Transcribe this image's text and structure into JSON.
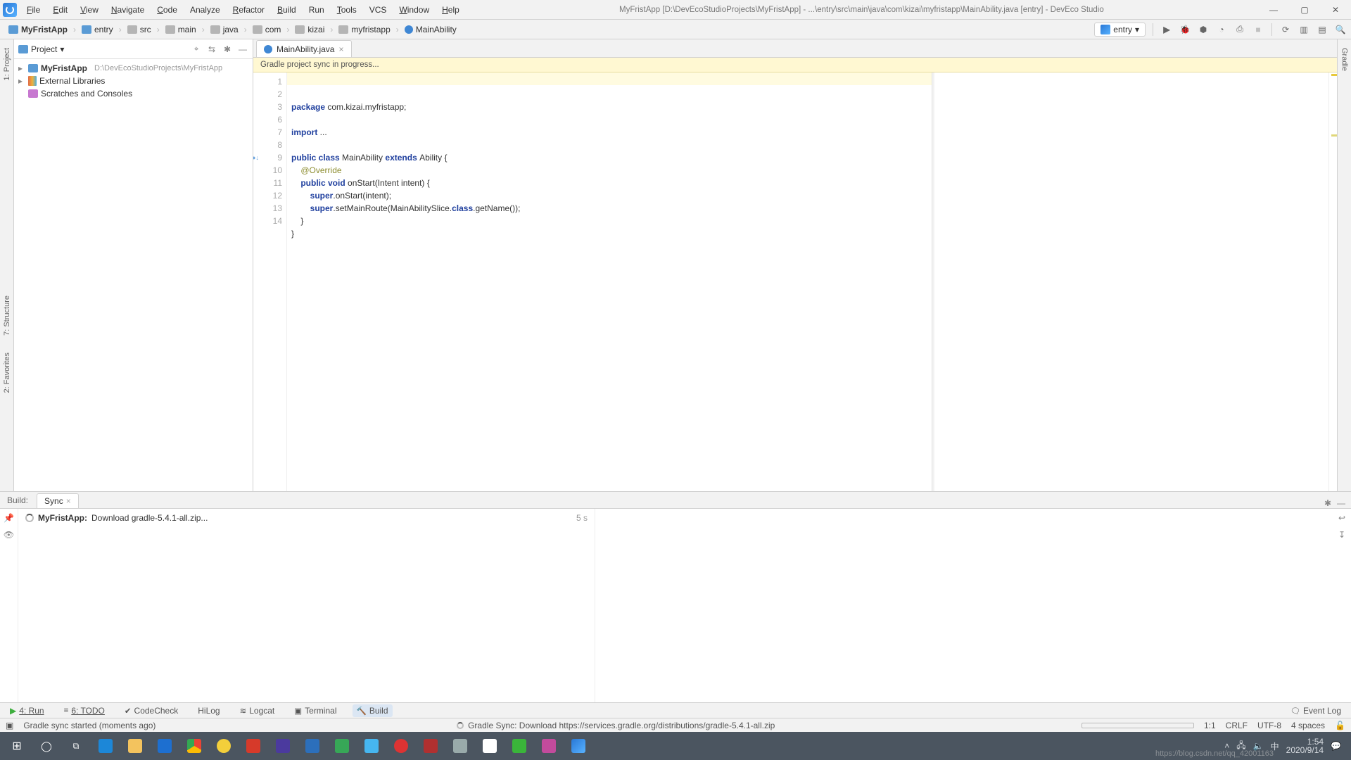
{
  "app": {
    "title_main": "MyFristApp [D:\\DevEcoStudioProjects\\MyFristApp] - ...\\entry\\src\\main\\java\\com\\kizai\\myfristapp\\MainAbility.java [entry] - DevEco Studio"
  },
  "menu": {
    "file": "File",
    "edit": "Edit",
    "view": "View",
    "navigate": "Navigate",
    "code": "Code",
    "analyze": "Analyze",
    "refactor": "Refactor",
    "build": "Build",
    "run": "Run",
    "tools": "Tools",
    "vcs": "VCS",
    "window": "Window",
    "help": "Help"
  },
  "crumbs": [
    "MyFristApp",
    "entry",
    "src",
    "main",
    "java",
    "com",
    "kizai",
    "myfristapp",
    "MainAbility"
  ],
  "run_config": {
    "label": "entry"
  },
  "sidebar": {
    "title": "Project",
    "tree": {
      "root": "MyFristApp",
      "root_hint": "D:\\DevEcoStudioProjects\\MyFristApp",
      "ext_lib": "External Libraries",
      "scratch": "Scratches and Consoles"
    }
  },
  "left_tabs": {
    "project": "1: Project",
    "structure": "7: Structure",
    "favorites": "2: Favorites"
  },
  "right_tabs": {
    "gradle": "Gradle"
  },
  "editor": {
    "tab": "MainAbility.java",
    "notice": "Gradle project sync in progress...",
    "lines": [
      "1",
      "2",
      "3",
      "6",
      "7",
      "8",
      "9",
      "10",
      "11",
      "12",
      "13",
      "14"
    ]
  },
  "code": {
    "l1_a": "package",
    "l1_b": " com.kizai.myfristapp;",
    "l3_a": "import",
    "l3_b": " ...",
    "l7_a": "public class ",
    "l7_b": "MainAbility",
    "l7_c": " extends ",
    "l7_d": "Ability {",
    "l8": "@Override",
    "l9_a": "public void ",
    "l9_b": "onStart(Intent intent) {",
    "l10_a": "super",
    "l10_b": ".onStart(intent);",
    "l11_a": "super",
    "l11_b": ".setMainRoute(MainAbilitySlice.",
    "l11_c": "class",
    "l11_d": ".getName());",
    "l12": "}",
    "l13": "}"
  },
  "build": {
    "title": "Build:",
    "tab": "Sync",
    "row_project": "MyFristApp:",
    "row_msg": " Download gradle-5.4.1-all.zip...",
    "row_time": "5 s"
  },
  "bottom": {
    "run": "4: Run",
    "todo": "6: TODO",
    "codecheck": "CodeCheck",
    "hilog": "HiLog",
    "logcat": "Logcat",
    "terminal": "Terminal",
    "build": "Build",
    "eventlog": "Event Log"
  },
  "status": {
    "left": "Gradle sync started (moments ago)",
    "mid": "Gradle Sync: Download https://services.gradle.org/distributions/gradle-5.4.1-all.zip",
    "pos": "1:1",
    "crlf": "CRLF",
    "enc": "UTF-8",
    "indent": "4 spaces"
  },
  "taskbar": {
    "time": "1:54",
    "date": "2020/9/14",
    "watermark": "https://blog.csdn.net/qq_42001163"
  }
}
